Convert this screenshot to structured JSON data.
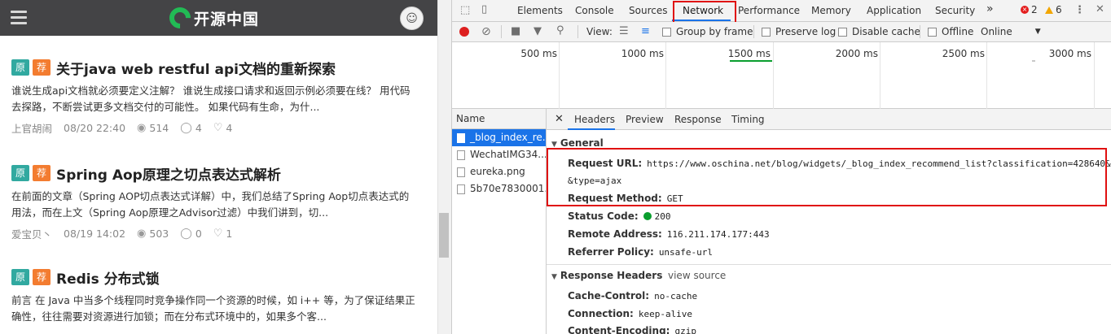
{
  "site": {
    "brand": "开源中国",
    "articles": [
      {
        "tag_orig": "原",
        "tag_rec": "荐",
        "title": "关于java web restful api文档的重新探索",
        "desc": "谁说生成api文档就必须要定义注解？ 谁说生成接口请求和返回示例必须要在线？ 用代码去探路，不断尝试更多文档交付的可能性。 如果代码有生命，为什...",
        "author": "上官胡闹",
        "date": "08/20 22:40",
        "views": "514",
        "comments": "4",
        "likes": "4"
      },
      {
        "tag_orig": "原",
        "tag_rec": "荐",
        "title": "Spring Aop原理之切点表达式解析",
        "desc": "在前面的文章（Spring AOP切点表达式详解）中，我们总结了Spring Aop切点表达式的用法，而在上文（Spring Aop原理之Advisor过滤）中我们讲到，切...",
        "author": "爱宝贝丶",
        "date": "08/19 14:02",
        "views": "503",
        "comments": "0",
        "likes": "1"
      },
      {
        "tag_orig": "原",
        "tag_rec": "荐",
        "title": "Redis 分布式锁",
        "desc": "前言 在 Java 中当多个线程同时竞争操作同一个资源的时候，如 i++ 等，为了保证结果正确性，往往需要对资源进行加锁；而在分布式环境中的，如果多个客...",
        "author": "",
        "date": "",
        "views": "",
        "comments": "",
        "likes": ""
      }
    ]
  },
  "devtools": {
    "tabs": [
      "Elements",
      "Console",
      "Sources",
      "Network",
      "Performance",
      "Memory",
      "Application",
      "Security"
    ],
    "more": "»",
    "errors": "2",
    "warnings": "6",
    "toolbar": {
      "view_label": "View:",
      "group_by_frame": "Group by frame",
      "preserve_log": "Preserve log",
      "disable_cache": "Disable cache",
      "offline": "Offline",
      "throttle": "Online"
    },
    "timeline_ticks": [
      "500 ms",
      "1000 ms",
      "1500 ms",
      "2000 ms",
      "2500 ms",
      "3000 ms"
    ],
    "name_header": "Name",
    "requests": [
      "_blog_index_re...",
      "WechatIMG34...",
      "eureka.png",
      "5b70e7830001..."
    ],
    "detail_tabs": [
      "Headers",
      "Preview",
      "Response",
      "Timing"
    ],
    "general": {
      "title": "General",
      "request_url_label": "Request URL:",
      "request_url": "https://www.oschina.net/blog/widgets/_blog_index_recommend_list?classification=428640&p",
      "request_url_cont": "&type=ajax",
      "request_method_label": "Request Method:",
      "request_method": "GET",
      "status_code_label": "Status Code:",
      "status_code": "200",
      "remote_address_label": "Remote Address:",
      "remote_address": "116.211.174.177:443",
      "referrer_policy_label": "Referrer Policy:",
      "referrer_policy": "unsafe-url"
    },
    "response_headers": {
      "title": "Response Headers",
      "view_source": "view source",
      "cache_control_label": "Cache-Control:",
      "cache_control": "no-cache",
      "connection_label": "Connection:",
      "connection": "keep-alive",
      "content_encoding_label": "Content-Encoding:",
      "content_encoding": "gzip"
    },
    "colors": {
      "accent": "#1a73e8",
      "highlight_box": "#e01010"
    }
  }
}
